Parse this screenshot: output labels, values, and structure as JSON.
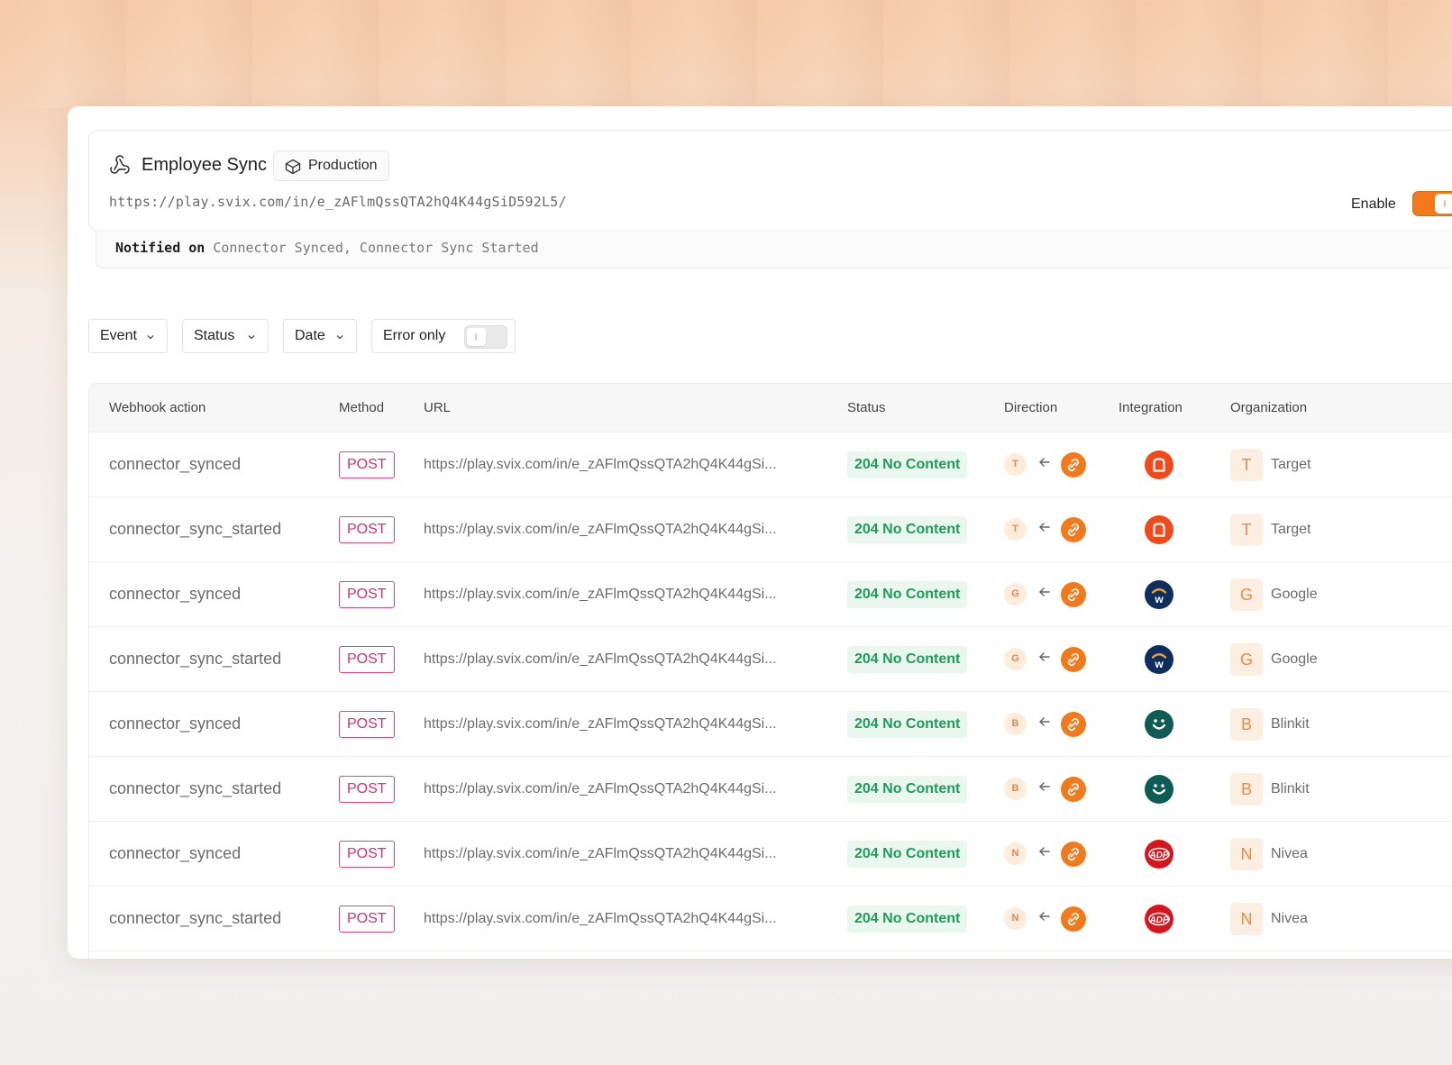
{
  "header": {
    "title": "Employee Sync",
    "environment": "Production",
    "endpoint_url": "https://play.svix.com/in/e_zAFlmQssQTA2hQ4K44gSiD592L5/",
    "enable_label": "Enable",
    "enabled": true,
    "notified_label": "Notified on",
    "notified_events": "Connector Synced, Connector Sync Started"
  },
  "filters": {
    "event": "Event",
    "status": "Status",
    "date": "Date",
    "error_only": "Error only",
    "error_only_enabled": false
  },
  "table": {
    "columns": [
      "Webhook action",
      "Method",
      "URL",
      "Status",
      "Direction",
      "Integration",
      "Organization"
    ],
    "rows": [
      {
        "action": "connector_synced",
        "method": "POST",
        "url": "https://play.svix.com/in/e_zAFlmQssQTA2hQ4K44gSi...",
        "status": "204 No Content",
        "dir_letter": "T",
        "integration_icon": "red-square-logo-icon",
        "org_initial": "T",
        "org_name": "Target"
      },
      {
        "action": "connector_sync_started",
        "method": "POST",
        "url": "https://play.svix.com/in/e_zAFlmQssQTA2hQ4K44gSi...",
        "status": "204 No Content",
        "dir_letter": "T",
        "integration_icon": "red-square-logo-icon",
        "org_initial": "T",
        "org_name": "Target"
      },
      {
        "action": "connector_synced",
        "method": "POST",
        "url": "https://play.svix.com/in/e_zAFlmQssQTA2hQ4K44gSi...",
        "status": "204 No Content",
        "dir_letter": "G",
        "integration_icon": "workday-logo-icon",
        "org_initial": "G",
        "org_name": "Google"
      },
      {
        "action": "connector_sync_started",
        "method": "POST",
        "url": "https://play.svix.com/in/e_zAFlmQssQTA2hQ4K44gSi...",
        "status": "204 No Content",
        "dir_letter": "G",
        "integration_icon": "workday-logo-icon",
        "org_initial": "G",
        "org_name": "Google"
      },
      {
        "action": "connector_synced",
        "method": "POST",
        "url": "https://play.svix.com/in/e_zAFlmQssQTA2hQ4K44gSi...",
        "status": "204 No Content",
        "dir_letter": "B",
        "integration_icon": "smile-logo-icon",
        "org_initial": "B",
        "org_name": "Blinkit"
      },
      {
        "action": "connector_sync_started",
        "method": "POST",
        "url": "https://play.svix.com/in/e_zAFlmQssQTA2hQ4K44gSi...",
        "status": "204 No Content",
        "dir_letter": "B",
        "integration_icon": "smile-logo-icon",
        "org_initial": "B",
        "org_name": "Blinkit"
      },
      {
        "action": "connector_synced",
        "method": "POST",
        "url": "https://play.svix.com/in/e_zAFlmQssQTA2hQ4K44gSi...",
        "status": "204 No Content",
        "dir_letter": "N",
        "integration_icon": "adp-logo-icon",
        "org_initial": "N",
        "org_name": "Nivea"
      },
      {
        "action": "connector_sync_started",
        "method": "POST",
        "url": "https://play.svix.com/in/e_zAFlmQssQTA2hQ4K44gSi...",
        "status": "204 No Content",
        "dir_letter": "N",
        "integration_icon": "adp-logo-icon",
        "org_initial": "N",
        "org_name": "Nivea"
      }
    ]
  },
  "colors": {
    "accent": "#f27a1a",
    "method_pink": "#e02c6a",
    "status_green": "#1f9b5a",
    "integration_red": "#f04a1c",
    "workday_navy": "#0d2e5e",
    "smile_teal": "#0e5c55",
    "adp_red": "#d8141c"
  }
}
